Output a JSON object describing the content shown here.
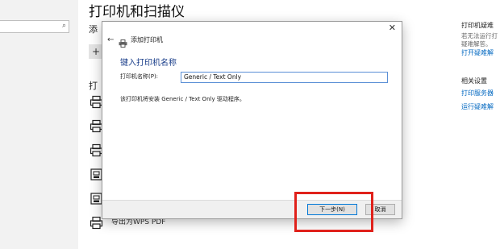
{
  "settings": {
    "page_title": "打印机和扫描仪",
    "add_label": "添",
    "add_button_label": "+",
    "printers_label": "打",
    "printer_partial_name": "导出为WPS PDF",
    "right_pane": {
      "help_heading": "打印机疑难",
      "help_text_1": "若无法运行打",
      "help_text_2": "疑难解答。",
      "help_link": "打开疑难解",
      "related_heading": "相关设置",
      "related_link_1": "打印服务器",
      "related_link_2": "运行疑难解"
    }
  },
  "dialog": {
    "title": "添加打印机",
    "heading": "键入打印机名称",
    "name_label": "打印机名称(P):",
    "name_value": "Generic / Text Only",
    "driver_note": "该打印机将安装 Generic / Text Only 驱动程序。",
    "next_label": "下一步(N)",
    "cancel_label": "取消"
  },
  "colors": {
    "accent": "#0067c0",
    "heading_blue": "#1a3e8a",
    "highlight": "#e0211b"
  }
}
